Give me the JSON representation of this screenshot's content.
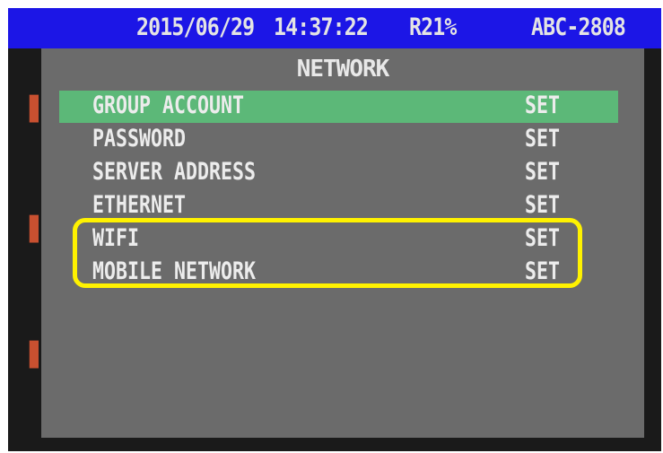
{
  "status_bar": {
    "date": "2015/06/29",
    "time": "14:37:22",
    "indicator": "R21%",
    "device_id": "ABC-2808"
  },
  "menu": {
    "title": "NETWORK",
    "items": [
      {
        "label": "GROUP ACCOUNT",
        "value": "SET",
        "selected": true
      },
      {
        "label": "PASSWORD",
        "value": "SET",
        "selected": false
      },
      {
        "label": "SERVER ADDRESS",
        "value": "SET",
        "selected": false
      },
      {
        "label": "ETHERNET",
        "value": "SET",
        "selected": false
      },
      {
        "label": "WIFI",
        "value": "SET",
        "selected": false
      },
      {
        "label": "MOBILE NETWORK",
        "value": "SET",
        "selected": false
      }
    ]
  },
  "colors": {
    "status_bar_bg": "#1c16e6",
    "panel_bg": "#6b6b6b",
    "selection_bg": "#5cb878",
    "highlight_outline": "#fff200"
  }
}
